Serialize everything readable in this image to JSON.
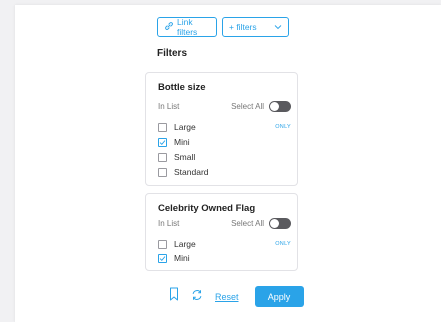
{
  "toolbar": {
    "link_filters_label": "Link filters",
    "add_filters_label": "+ filters"
  },
  "heading": "Filters",
  "groups": [
    {
      "title": "Bottle size",
      "in_list_label": "In List",
      "select_all_label": "Select All",
      "only_label": "ONLY",
      "options": [
        {
          "label": "Large",
          "checked": false
        },
        {
          "label": "Mini",
          "checked": true
        },
        {
          "label": "Small",
          "checked": false
        },
        {
          "label": "Standard",
          "checked": false
        }
      ]
    },
    {
      "title": "Celebrity Owned Flag",
      "in_list_label": "In List",
      "select_all_label": "Select All",
      "only_label": "ONLY",
      "options": [
        {
          "label": "Large",
          "checked": false
        },
        {
          "label": "Mini",
          "checked": true
        }
      ]
    }
  ],
  "footer": {
    "reset_label": "Reset",
    "apply_label": "Apply"
  },
  "colors": {
    "accent": "#2aa3e8",
    "toggle": "#5a5a5e"
  },
  "icons": [
    "link-icon",
    "chevron-down-icon",
    "bookmark-icon",
    "refresh-icon"
  ]
}
